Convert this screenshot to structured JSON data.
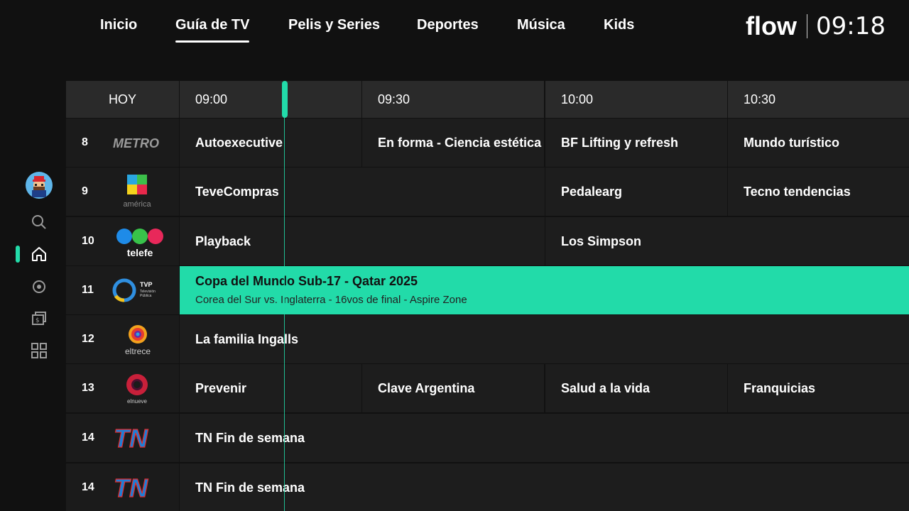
{
  "nav": {
    "items": [
      {
        "label": "Inicio",
        "active": false
      },
      {
        "label": "Guía de TV",
        "active": true
      },
      {
        "label": "Pelis y Series",
        "active": false
      },
      {
        "label": "Deportes",
        "active": false
      },
      {
        "label": "Música",
        "active": false
      },
      {
        "label": "Kids",
        "active": false
      }
    ],
    "brand": "flow",
    "clock": "09:18"
  },
  "rail": {
    "items": [
      "avatar",
      "search-icon",
      "home-icon",
      "record-icon",
      "rent-icon",
      "apps-icon"
    ],
    "active": "home-icon",
    "accent": "#23dba9"
  },
  "guide": {
    "today_label": "HOY",
    "times": [
      "09:00",
      "09:30",
      "10:00",
      "10:30"
    ],
    "current_time_label": "09:18",
    "channels": [
      {
        "number": "8",
        "logo": "METRO",
        "programs": [
          "Autoexecutive",
          "En forma - Ciencia estética",
          "BF Lifting y refresh",
          "Mundo turístico"
        ]
      },
      {
        "number": "9",
        "logo": "américa",
        "programs": [
          "TeveCompras",
          "Pedalearg",
          "Tecno tendencias"
        ]
      },
      {
        "number": "10",
        "logo": "telefe",
        "programs": [
          "Playback",
          "Los Simpson"
        ]
      },
      {
        "number": "11",
        "logo": "TVP",
        "logo_sub": "Televisión Pública",
        "programs": [
          {
            "title": "Copa del Mundo Sub-17 - Qatar 2025",
            "subtitle": "Corea del Sur vs. Inglaterra - 16vos de final - Aspire Zone"
          }
        ]
      },
      {
        "number": "12",
        "logo": "eltrece",
        "programs": [
          "La familia Ingalls"
        ]
      },
      {
        "number": "13",
        "logo": "elnueve",
        "programs": [
          "Prevenir",
          "Clave Argentina",
          "Salud a la vida",
          "Franquicias"
        ]
      },
      {
        "number": "14",
        "logo": "TN",
        "programs": [
          "TN Fin de semana"
        ]
      },
      {
        "number": "14",
        "logo": "TN",
        "programs": [
          "TN Fin de semana"
        ]
      }
    ]
  },
  "colors": {
    "background": "#111111",
    "highlight": "#22dba9",
    "header_cell": "#2a2a2a",
    "program_cell": "#1d1d1d"
  }
}
